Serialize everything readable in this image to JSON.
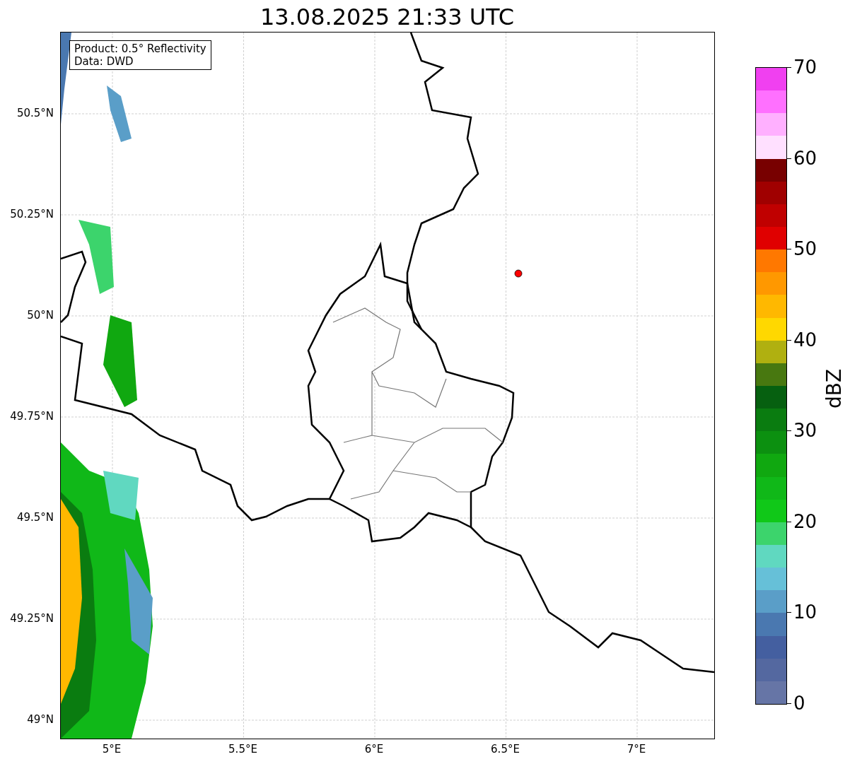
{
  "title": "13.08.2025 21:33 UTC",
  "map": {
    "info_box": [
      "Product: 0.5° Reflectivity",
      "Data: DWD"
    ],
    "lat_labels": [
      "50.5°N",
      "50.25°N",
      "50°N",
      "49.75°N",
      "49.5°N",
      "49.25°N",
      "49°N"
    ],
    "lon_labels": [
      "5°E",
      "5.5°E",
      "6°E",
      "6.5°E",
      "7°E"
    ]
  },
  "colorbar": {
    "label": "dBZ",
    "ticks": [
      "70",
      "60",
      "50",
      "40",
      "30",
      "20",
      "10",
      "0"
    ],
    "bands": [
      {
        "color": "#6675a6"
      },
      {
        "color": "#5468a0"
      },
      {
        "color": "#445fa0"
      },
      {
        "color": "#4a78b0"
      },
      {
        "color": "#5a9ec8"
      },
      {
        "color": "#66c0d8"
      },
      {
        "color": "#60d8c0"
      },
      {
        "color": "#3cd46c"
      },
      {
        "color": "#10c818"
      },
      {
        "color": "#10b818"
      },
      {
        "color": "#10a810"
      },
      {
        "color": "#0c9010"
      },
      {
        "color": "#0a7c10"
      },
      {
        "color": "#066010"
      },
      {
        "color": "#487810"
      },
      {
        "color": "#b0b010"
      },
      {
        "color": "#ffd800"
      },
      {
        "color": "#ffb800"
      },
      {
        "color": "#ff9800"
      },
      {
        "color": "#ff7800"
      },
      {
        "color": "#e00000"
      },
      {
        "color": "#c00000"
      },
      {
        "color": "#a00000"
      },
      {
        "color": "#780000"
      },
      {
        "color": "#ffe0ff"
      },
      {
        "color": "#ffb0ff"
      },
      {
        "color": "#ff70ff"
      },
      {
        "color": "#f040f0"
      }
    ]
  }
}
